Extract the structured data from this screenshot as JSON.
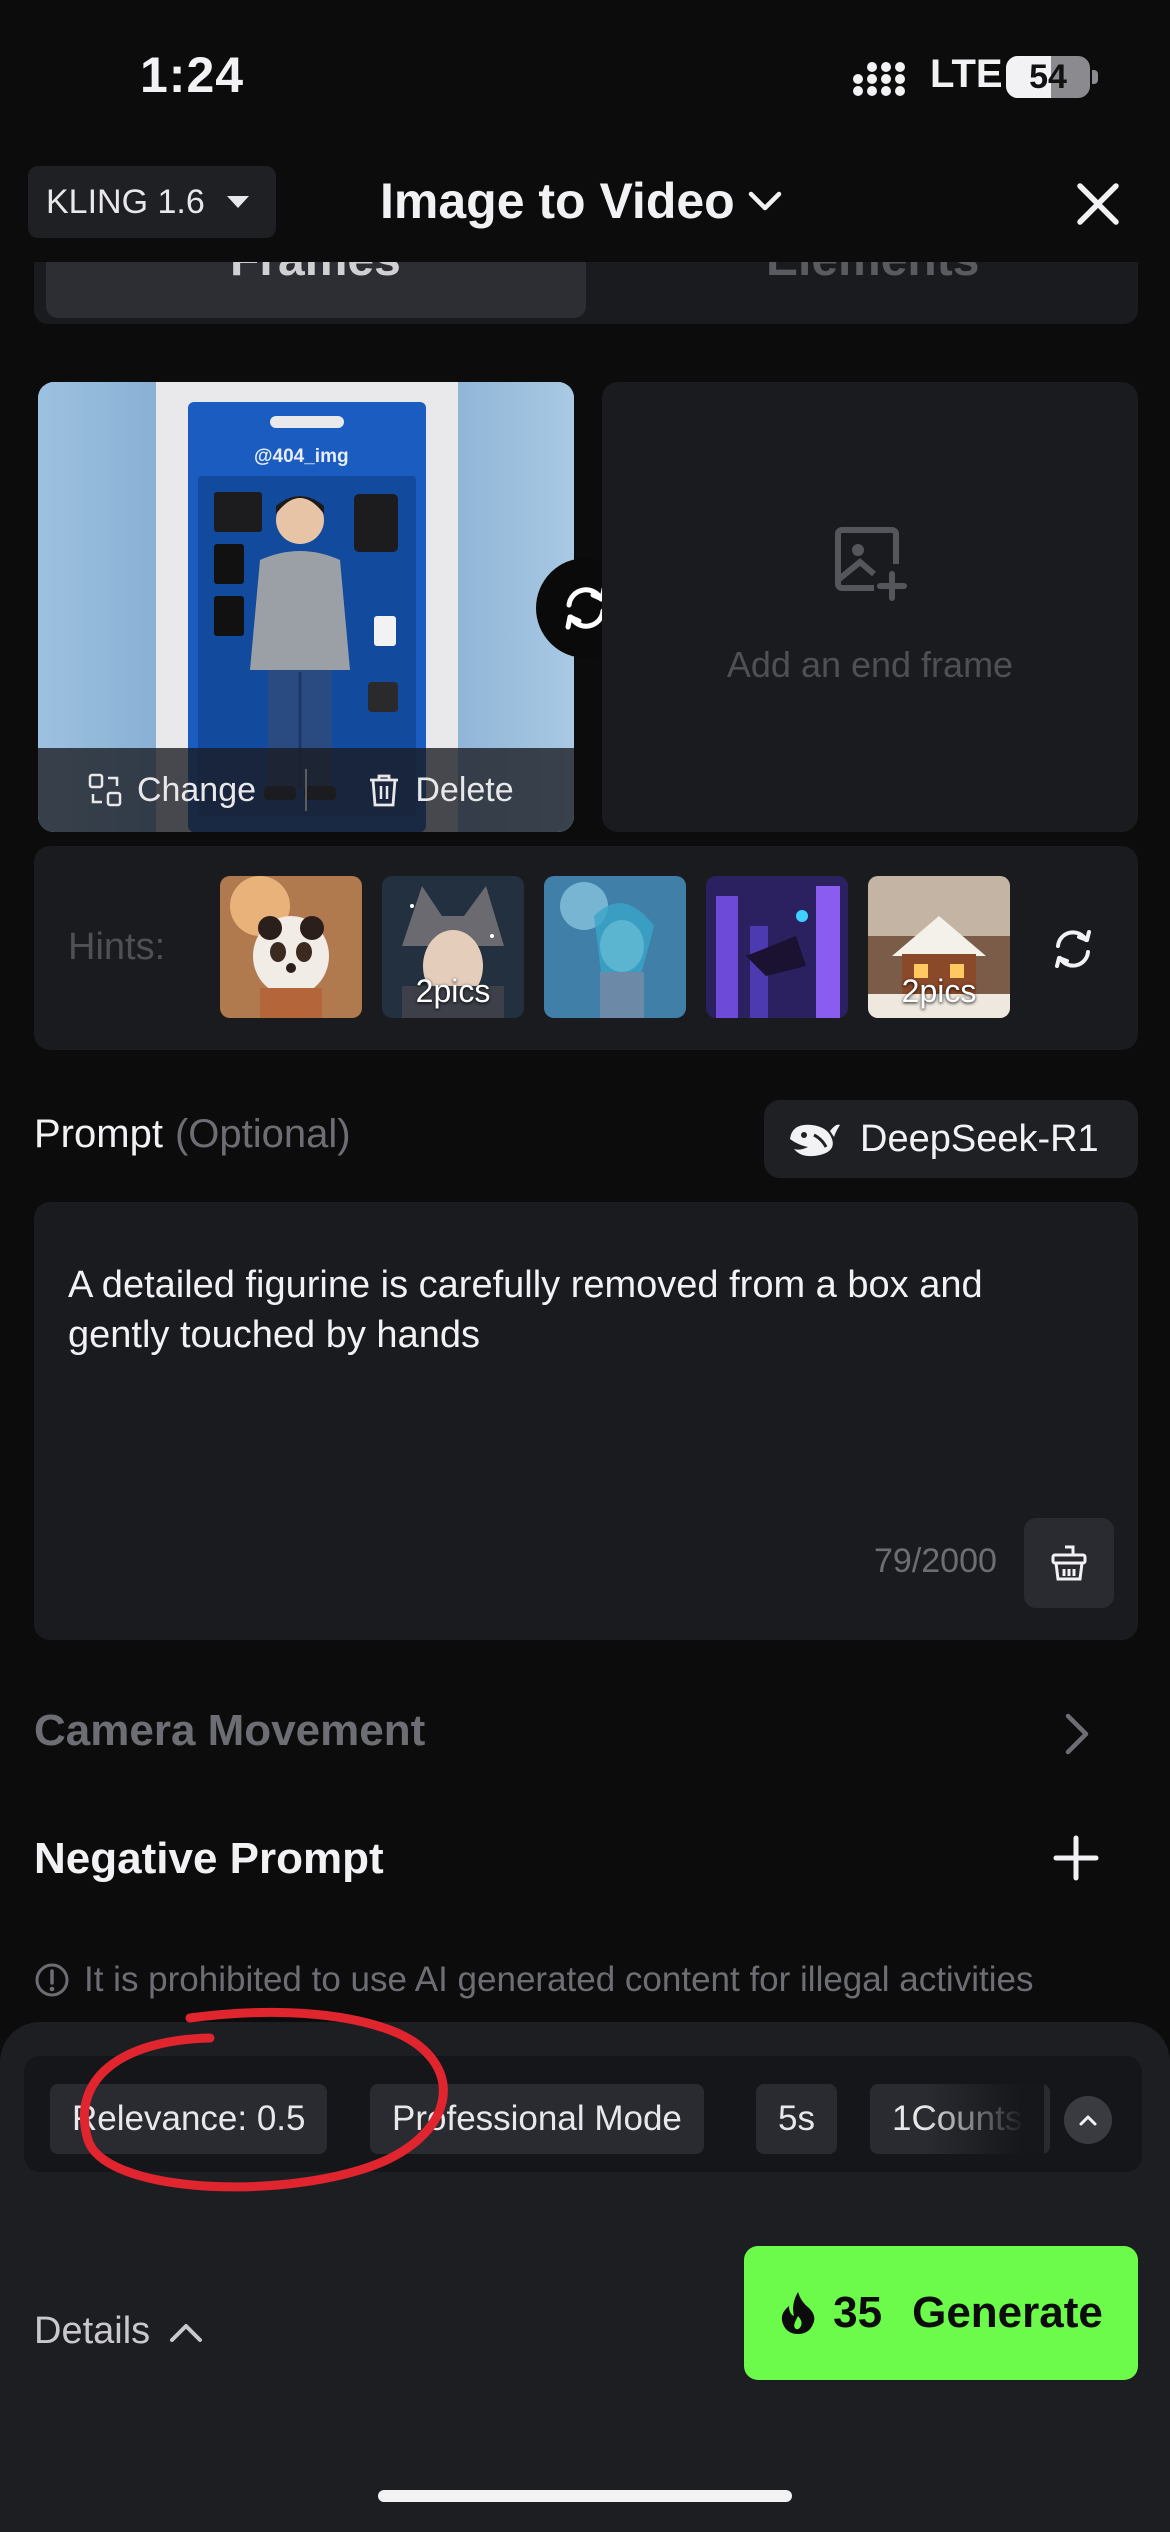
{
  "status_bar": {
    "time": "1:24",
    "network": "LTE",
    "battery": "54",
    "battery_level": 0.54
  },
  "header": {
    "model": "KLING 1.6",
    "title": "Image to Video"
  },
  "tabs": [
    {
      "label": "Frames"
    },
    {
      "label": "Elements"
    }
  ],
  "frames": {
    "start": {
      "watermark": "@404_img",
      "change_label": "Change",
      "delete_label": "Delete"
    },
    "end": {
      "label": "Add an end frame"
    }
  },
  "hints": {
    "label": "Hints:",
    "items": [
      {
        "badge": ""
      },
      {
        "badge": "2pics"
      },
      {
        "badge": ""
      },
      {
        "badge": ""
      },
      {
        "badge": "2pics"
      }
    ]
  },
  "prompt": {
    "label": "Prompt",
    "optional": "(Optional)",
    "assistant": "DeepSeek-R1",
    "text": "A detailed figurine is carefully removed from a box and gently touched by hands",
    "count": "79/2000"
  },
  "camera_movement": {
    "label": "Camera Movement"
  },
  "negative_prompt": {
    "label": "Negative Prompt"
  },
  "warning": {
    "text": "It is prohibited to use AI generated content for illegal activities"
  },
  "settings": {
    "relevance": "Relevance: 0.5",
    "mode": "Professional Mode",
    "duration": "5s",
    "counts": "1Counts"
  },
  "footer": {
    "details": "Details",
    "credits": "35",
    "generate": "Generate"
  },
  "colors": {
    "accent": "#6cfb4a",
    "annotation": "#e0252f",
    "background": "#0c0c0d"
  }
}
